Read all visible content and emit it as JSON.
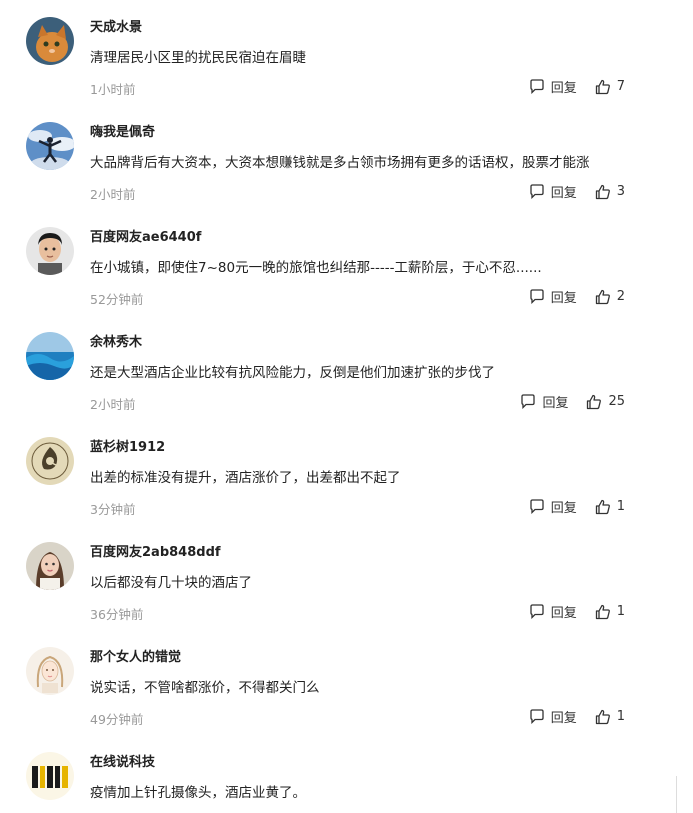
{
  "comments": [
    {
      "name": "天成水景",
      "text": "清理居民小区里的扰民民宿迫在眉睫",
      "time": "1小时前",
      "reply_label": "回复",
      "likes": "7",
      "avatar_icon": "cat-photo-avatar"
    },
    {
      "name": "嗨我是佩奇",
      "text": "大品牌背后有大资本，大资本想赚钱就是多占领市场拥有更多的话语权，股票才能涨",
      "time": "2小时前",
      "reply_label": "回复",
      "likes": "3",
      "avatar_icon": "sky-jump-avatar"
    },
    {
      "name": "百度网友ae6440f",
      "text": "在小城镇，即使住7~80元一晚的旅馆也纠结那-----工薪阶层，于心不忍......",
      "time": "52分钟前",
      "reply_label": "回复",
      "likes": "2",
      "avatar_icon": "man-portrait-avatar"
    },
    {
      "name": "余林秀木",
      "text": "还是大型酒店企业比较有抗风险能力，反倒是他们加速扩张的步伐了",
      "time": "2小时前",
      "reply_label": "回复",
      "likes": "25",
      "avatar_icon": "ocean-wave-avatar"
    },
    {
      "name": "蓝杉树1912",
      "text": "出差的标准没有提升，酒店涨价了，出差都出不起了",
      "time": "3分钟前",
      "reply_label": "回复",
      "likes": "1",
      "avatar_icon": "leaf-emblem-avatar"
    },
    {
      "name": "百度网友2ab848ddf",
      "text": "以后都没有几十块的酒店了",
      "time": "36分钟前",
      "reply_label": "回复",
      "likes": "1",
      "avatar_icon": "woman-portrait-avatar"
    },
    {
      "name": "那个女人的错觉",
      "text": "说实话，不管啥都涨价，不得都关门么",
      "time": "49分钟前",
      "reply_label": "回复",
      "likes": "1",
      "avatar_icon": "sketch-girl-avatar"
    },
    {
      "name": "在线说科技",
      "text": "疫情加上针孔摄像头，酒店业黄了。",
      "time": "",
      "reply_label": "",
      "likes": "",
      "avatar_icon": "logo-text-avatar"
    }
  ]
}
